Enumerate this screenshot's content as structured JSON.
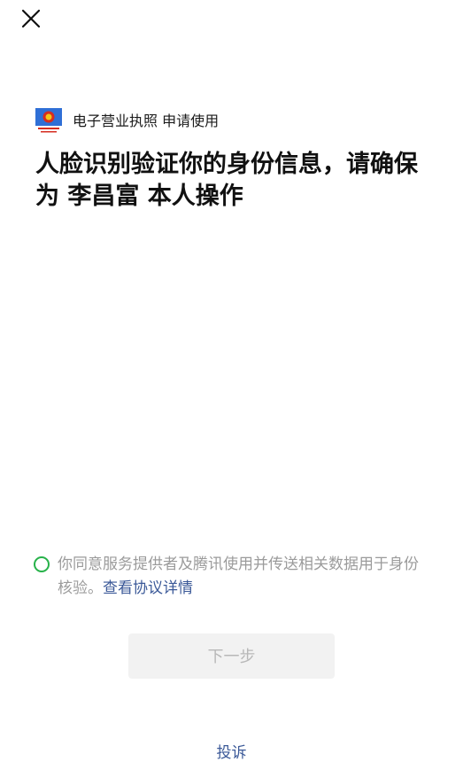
{
  "header": {
    "close_icon": "close-icon"
  },
  "app": {
    "logo_icon": "national-emblem-icon",
    "name": "电子营业执照 申请使用"
  },
  "main": {
    "headline": "人脸识别验证你的身份信息，请确保为 李昌富 本人操作"
  },
  "consent": {
    "checked": false,
    "accent_color": "#27b24a",
    "text": "你同意服务提供者及腾讯使用并传送相关数据用于身份核验。",
    "link_label": "查看协议详情"
  },
  "actions": {
    "next_label": "下一步",
    "next_enabled": false
  },
  "footer": {
    "complain_label": "投诉"
  }
}
